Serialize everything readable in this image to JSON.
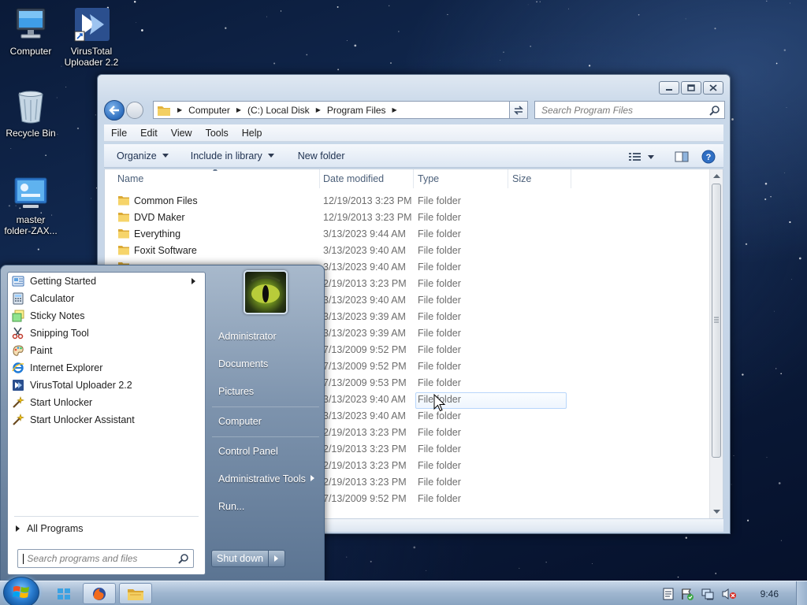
{
  "desktop": {
    "icons": [
      {
        "label_line1": "Computer",
        "label_line2": ""
      },
      {
        "label_line1": "VirusTotal",
        "label_line2": "Uploader 2.2"
      },
      {
        "label_line1": "Recycle Bin",
        "label_line2": ""
      },
      {
        "label_line1": "master",
        "label_line2": "folder-ZAX..."
      }
    ]
  },
  "explorer": {
    "breadcrumb": [
      "Computer",
      "(C:) Local Disk",
      "Program Files"
    ],
    "search_placeholder": "Search Program Files",
    "menu": [
      "File",
      "Edit",
      "View",
      "Tools",
      "Help"
    ],
    "toolbar": {
      "organize": "Organize",
      "include": "Include in library",
      "new_folder": "New folder"
    },
    "columns": {
      "name": "Name",
      "date": "Date modified",
      "type": "Type",
      "size": "Size"
    },
    "rows": [
      {
        "name": "Common Files",
        "date": "12/19/2013 3:23 PM",
        "type": "File folder"
      },
      {
        "name": "DVD Maker",
        "date": "12/19/2013 3:23 PM",
        "type": "File folder"
      },
      {
        "name": "Everything",
        "date": "3/13/2023 9:44 AM",
        "type": "File folder"
      },
      {
        "name": "Foxit Software",
        "date": "3/13/2023 9:40 AM",
        "type": "File folder"
      },
      {
        "name": "",
        "date": "3/13/2023 9:40 AM",
        "type": "File folder"
      },
      {
        "name": "",
        "date": "2/19/2013 3:23 PM",
        "type": "File folder"
      },
      {
        "name": "",
        "date": "3/13/2023 9:40 AM",
        "type": "File folder"
      },
      {
        "name": "",
        "date": "3/13/2023 9:39 AM",
        "type": "File folder"
      },
      {
        "name": "",
        "date": "3/13/2023 9:39 AM",
        "type": "File folder"
      },
      {
        "name": "",
        "date": "7/13/2009 9:52 PM",
        "type": "File folder"
      },
      {
        "name": "",
        "date": "7/13/2009 9:52 PM",
        "type": "File folder"
      },
      {
        "name": "",
        "date": "7/13/2009 9:53 PM",
        "type": "File folder"
      },
      {
        "name": "",
        "date": "3/13/2023 9:40 AM",
        "type": "File folder"
      },
      {
        "name": "",
        "date": "3/13/2023 9:40 AM",
        "type": "File folder"
      },
      {
        "name": "",
        "date": "2/19/2013 3:23 PM",
        "type": "File folder"
      },
      {
        "name": "",
        "date": "2/19/2013 3:23 PM",
        "type": "File folder"
      },
      {
        "name": "",
        "date": "2/19/2013 3:23 PM",
        "type": "File folder"
      },
      {
        "name": "",
        "date": "2/19/2013 3:23 PM",
        "type": "File folder"
      },
      {
        "name": "",
        "date": "7/13/2009 9:52 PM",
        "type": "File folder"
      }
    ]
  },
  "start_menu": {
    "programs": [
      {
        "label": "Getting Started",
        "icon": "getting-started-icon"
      },
      {
        "label": "Calculator",
        "icon": "calculator-icon"
      },
      {
        "label": "Sticky Notes",
        "icon": "sticky-notes-icon"
      },
      {
        "label": "Snipping Tool",
        "icon": "snipping-tool-icon"
      },
      {
        "label": "Paint",
        "icon": "paint-icon"
      },
      {
        "label": "Internet Explorer",
        "icon": "internet-explorer-icon"
      },
      {
        "label": "VirusTotal Uploader 2.2",
        "icon": "virustotal-icon"
      },
      {
        "label": "Start Unlocker",
        "icon": "wand-icon"
      },
      {
        "label": "Start Unlocker Assistant",
        "icon": "wand-icon"
      }
    ],
    "all_programs": "All Programs",
    "search_placeholder": "Search programs and files",
    "right": {
      "user": "Administrator",
      "documents": "Documents",
      "pictures": "Pictures",
      "computer": "Computer",
      "control_panel": "Control Panel",
      "admin_tools": "Administrative Tools",
      "run": "Run..."
    },
    "shutdown": "Shut down"
  },
  "taskbar": {
    "clock": "9:46",
    "pinned": [
      "metro-icon",
      "firefox-icon",
      "explorer-icon"
    ]
  },
  "colors": {
    "accent": "#2d6dbd",
    "folder": "#f2c94c"
  }
}
